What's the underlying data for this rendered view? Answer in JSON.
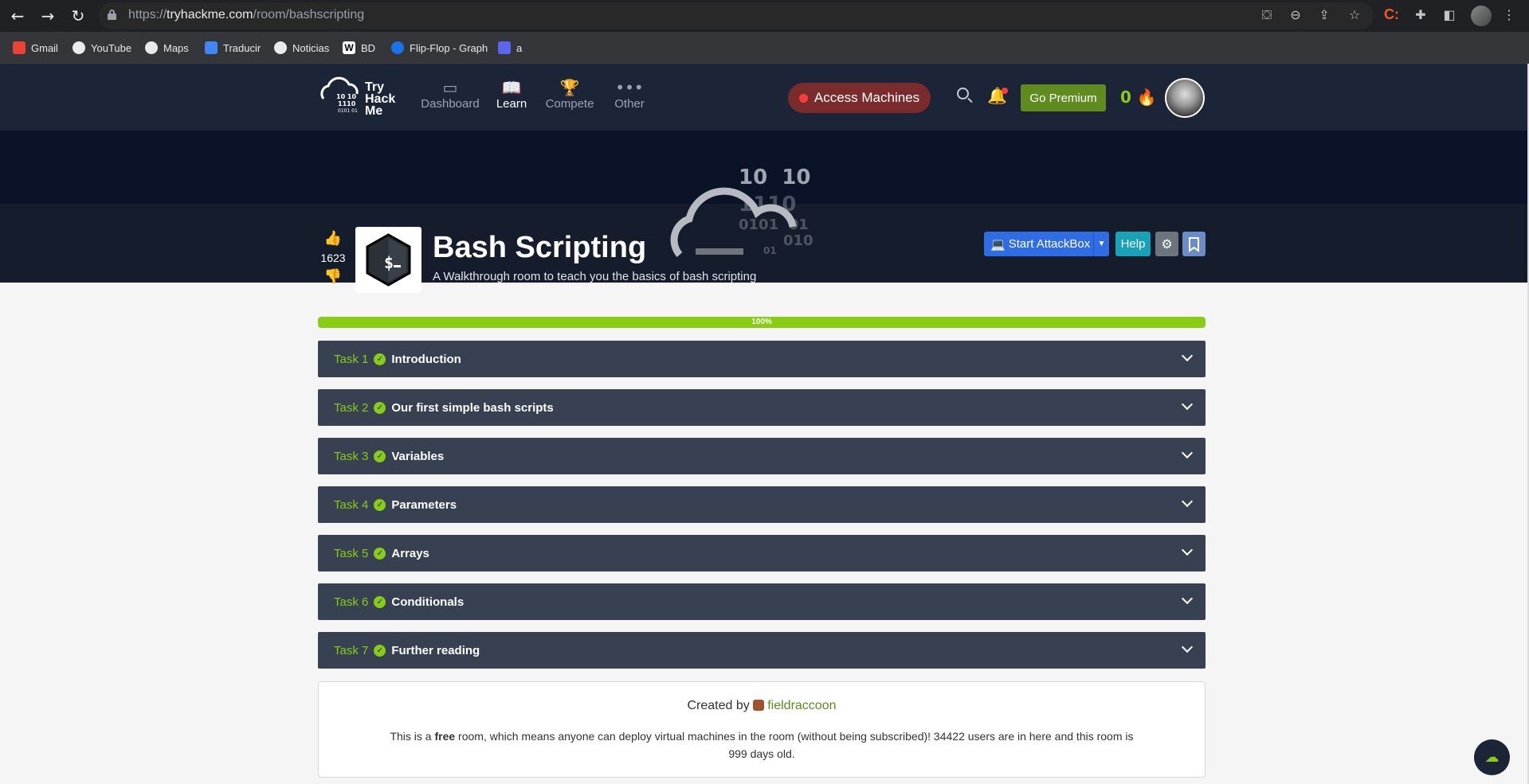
{
  "browser": {
    "url_scheme": "https://",
    "url_host": "tryhackme.com",
    "url_path": "/room/bashscripting",
    "bookmarks": [
      {
        "label": "Gmail",
        "color": "#ea4335"
      },
      {
        "label": "YouTube",
        "color": "#e8eaed"
      },
      {
        "label": "Maps",
        "color": "#e8eaed"
      },
      {
        "label": "Traducir",
        "color": "#4285f4"
      },
      {
        "label": "Noticias",
        "color": "#e8eaed"
      },
      {
        "label": "BD",
        "color": "#ffffff"
      },
      {
        "label": "Flip-Flop - Graph",
        "color": "#1a73e8"
      },
      {
        "label": "a",
        "color": "#5b67f1"
      }
    ]
  },
  "nav": {
    "logo_text": "Try Hack Me",
    "items": [
      {
        "label": "Dashboard",
        "icon": "calendar-icon"
      },
      {
        "label": "Learn",
        "icon": "book-icon",
        "active": true
      },
      {
        "label": "Compete",
        "icon": "trophy-icon"
      },
      {
        "label": "Other",
        "icon": "more-icon"
      }
    ],
    "access_machines": "Access Machines",
    "go_premium": "Go Premium",
    "streak": "0"
  },
  "room": {
    "title": "Bash Scripting",
    "subtitle": "A Walkthrough room to teach you the basics of bash scripting",
    "votes": "1623",
    "start_attackbox": "Start AttackBox",
    "help": "Help",
    "progress_percent": 100,
    "progress_label": "100%"
  },
  "tasks": [
    {
      "num": "Task 1",
      "title": "Introduction"
    },
    {
      "num": "Task 2",
      "title": "Our first simple bash scripts"
    },
    {
      "num": "Task 3",
      "title": "Variables"
    },
    {
      "num": "Task 4",
      "title": "Parameters"
    },
    {
      "num": "Task 5",
      "title": "Arrays"
    },
    {
      "num": "Task 6",
      "title": "Conditionals"
    },
    {
      "num": "Task 7",
      "title": "Further reading"
    }
  ],
  "creator": {
    "created_by": "Created by",
    "username": "fieldraccoon",
    "text_pre": "This is a ",
    "text_free": "free",
    "text_post": " room, which means anyone can deploy virtual machines in the room (without being subscribed)! 34422 users are in here and this room is 999 days old."
  },
  "colors": {
    "accent_green": "#88cc14",
    "nav_bg": "#1c2538",
    "task_bg": "#374152"
  }
}
